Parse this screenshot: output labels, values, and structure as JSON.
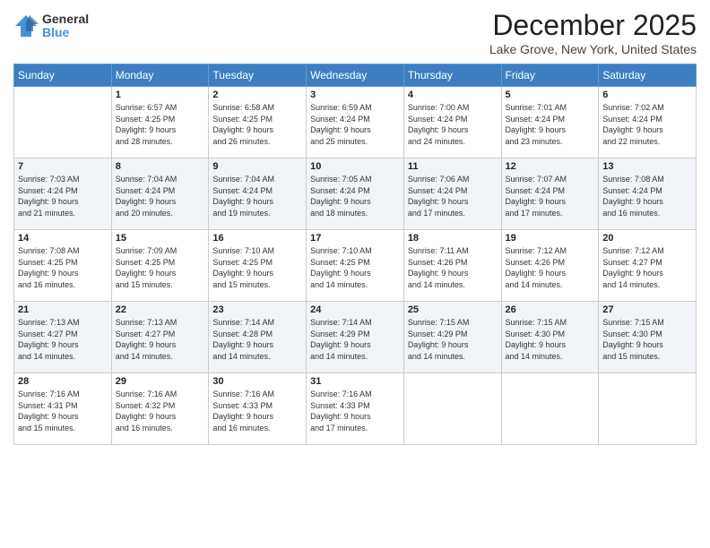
{
  "logo": {
    "line1": "General",
    "line2": "Blue"
  },
  "title": "December 2025",
  "location": "Lake Grove, New York, United States",
  "days_of_week": [
    "Sunday",
    "Monday",
    "Tuesday",
    "Wednesday",
    "Thursday",
    "Friday",
    "Saturday"
  ],
  "weeks": [
    [
      {
        "day": "",
        "info": ""
      },
      {
        "day": "1",
        "info": "Sunrise: 6:57 AM\nSunset: 4:25 PM\nDaylight: 9 hours\nand 28 minutes."
      },
      {
        "day": "2",
        "info": "Sunrise: 6:58 AM\nSunset: 4:25 PM\nDaylight: 9 hours\nand 26 minutes."
      },
      {
        "day": "3",
        "info": "Sunrise: 6:59 AM\nSunset: 4:24 PM\nDaylight: 9 hours\nand 25 minutes."
      },
      {
        "day": "4",
        "info": "Sunrise: 7:00 AM\nSunset: 4:24 PM\nDaylight: 9 hours\nand 24 minutes."
      },
      {
        "day": "5",
        "info": "Sunrise: 7:01 AM\nSunset: 4:24 PM\nDaylight: 9 hours\nand 23 minutes."
      },
      {
        "day": "6",
        "info": "Sunrise: 7:02 AM\nSunset: 4:24 PM\nDaylight: 9 hours\nand 22 minutes."
      }
    ],
    [
      {
        "day": "7",
        "info": "Sunrise: 7:03 AM\nSunset: 4:24 PM\nDaylight: 9 hours\nand 21 minutes."
      },
      {
        "day": "8",
        "info": "Sunrise: 7:04 AM\nSunset: 4:24 PM\nDaylight: 9 hours\nand 20 minutes."
      },
      {
        "day": "9",
        "info": "Sunrise: 7:04 AM\nSunset: 4:24 PM\nDaylight: 9 hours\nand 19 minutes."
      },
      {
        "day": "10",
        "info": "Sunrise: 7:05 AM\nSunset: 4:24 PM\nDaylight: 9 hours\nand 18 minutes."
      },
      {
        "day": "11",
        "info": "Sunrise: 7:06 AM\nSunset: 4:24 PM\nDaylight: 9 hours\nand 17 minutes."
      },
      {
        "day": "12",
        "info": "Sunrise: 7:07 AM\nSunset: 4:24 PM\nDaylight: 9 hours\nand 17 minutes."
      },
      {
        "day": "13",
        "info": "Sunrise: 7:08 AM\nSunset: 4:24 PM\nDaylight: 9 hours\nand 16 minutes."
      }
    ],
    [
      {
        "day": "14",
        "info": "Sunrise: 7:08 AM\nSunset: 4:25 PM\nDaylight: 9 hours\nand 16 minutes."
      },
      {
        "day": "15",
        "info": "Sunrise: 7:09 AM\nSunset: 4:25 PM\nDaylight: 9 hours\nand 15 minutes."
      },
      {
        "day": "16",
        "info": "Sunrise: 7:10 AM\nSunset: 4:25 PM\nDaylight: 9 hours\nand 15 minutes."
      },
      {
        "day": "17",
        "info": "Sunrise: 7:10 AM\nSunset: 4:25 PM\nDaylight: 9 hours\nand 14 minutes."
      },
      {
        "day": "18",
        "info": "Sunrise: 7:11 AM\nSunset: 4:26 PM\nDaylight: 9 hours\nand 14 minutes."
      },
      {
        "day": "19",
        "info": "Sunrise: 7:12 AM\nSunset: 4:26 PM\nDaylight: 9 hours\nand 14 minutes."
      },
      {
        "day": "20",
        "info": "Sunrise: 7:12 AM\nSunset: 4:27 PM\nDaylight: 9 hours\nand 14 minutes."
      }
    ],
    [
      {
        "day": "21",
        "info": "Sunrise: 7:13 AM\nSunset: 4:27 PM\nDaylight: 9 hours\nand 14 minutes."
      },
      {
        "day": "22",
        "info": "Sunrise: 7:13 AM\nSunset: 4:27 PM\nDaylight: 9 hours\nand 14 minutes."
      },
      {
        "day": "23",
        "info": "Sunrise: 7:14 AM\nSunset: 4:28 PM\nDaylight: 9 hours\nand 14 minutes."
      },
      {
        "day": "24",
        "info": "Sunrise: 7:14 AM\nSunset: 4:29 PM\nDaylight: 9 hours\nand 14 minutes."
      },
      {
        "day": "25",
        "info": "Sunrise: 7:15 AM\nSunset: 4:29 PM\nDaylight: 9 hours\nand 14 minutes."
      },
      {
        "day": "26",
        "info": "Sunrise: 7:15 AM\nSunset: 4:30 PM\nDaylight: 9 hours\nand 14 minutes."
      },
      {
        "day": "27",
        "info": "Sunrise: 7:15 AM\nSunset: 4:30 PM\nDaylight: 9 hours\nand 15 minutes."
      }
    ],
    [
      {
        "day": "28",
        "info": "Sunrise: 7:16 AM\nSunset: 4:31 PM\nDaylight: 9 hours\nand 15 minutes."
      },
      {
        "day": "29",
        "info": "Sunrise: 7:16 AM\nSunset: 4:32 PM\nDaylight: 9 hours\nand 16 minutes."
      },
      {
        "day": "30",
        "info": "Sunrise: 7:16 AM\nSunset: 4:33 PM\nDaylight: 9 hours\nand 16 minutes."
      },
      {
        "day": "31",
        "info": "Sunrise: 7:16 AM\nSunset: 4:33 PM\nDaylight: 9 hours\nand 17 minutes."
      },
      {
        "day": "",
        "info": ""
      },
      {
        "day": "",
        "info": ""
      },
      {
        "day": "",
        "info": ""
      }
    ]
  ]
}
